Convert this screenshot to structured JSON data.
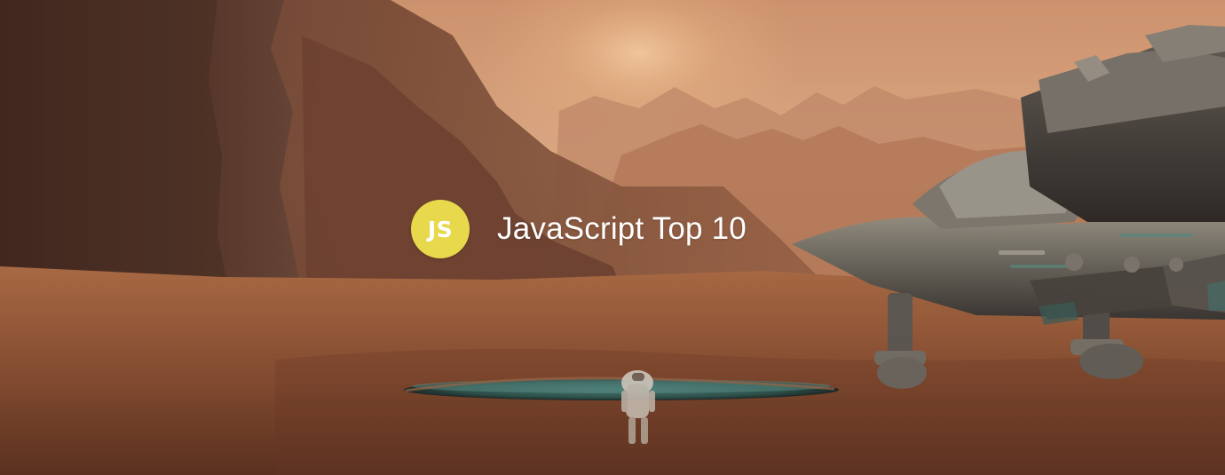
{
  "hero": {
    "badge_text": "JS",
    "title": "JavaScript Top 10",
    "badge_bg": "#e8d84b",
    "badge_fg": "#ffffff",
    "title_color": "#ffffff"
  }
}
